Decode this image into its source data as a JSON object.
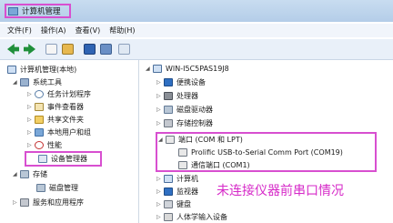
{
  "window": {
    "title": "计算机管理"
  },
  "menu": {
    "items": [
      "文件(F)",
      "操作(A)",
      "查看(V)",
      "帮助(H)"
    ]
  },
  "toolbar": {
    "icons": [
      "back-arrow",
      "forward-arrow",
      "up-folder",
      "properties",
      "help",
      "show-hide",
      "refresh"
    ]
  },
  "tree": {
    "root": "计算机管理(本地)",
    "system_tools": "系统工具",
    "task_scheduler": "任务计划程序",
    "event_viewer": "事件查看器",
    "shared_folders": "共享文件夹",
    "local_users": "本地用户和组",
    "performance": "性能",
    "device_manager": "设备管理器",
    "storage": "存储",
    "disk_management": "磁盘管理",
    "services": "服务和应用程序"
  },
  "devices": {
    "computer_name": "WIN-I5C5PAS19J8",
    "portable": "便携设备",
    "processor": "处理器",
    "disk_drives": "磁盘驱动器",
    "storage_controllers": "存储控制器",
    "ports": "端口 (COM 和 LPT)",
    "port1": "Prolific USB-to-Serial Comm Port (COM19)",
    "port2": "通信端口 (COM1)",
    "computer": "计算机",
    "monitors": "监视器",
    "keyboard": "键盘",
    "hid": "人体学输入设备"
  },
  "annotation": "未连接仪器前串口情况",
  "colors": {
    "highlight": "#d84fd0",
    "annotation": "#d62ac8"
  }
}
